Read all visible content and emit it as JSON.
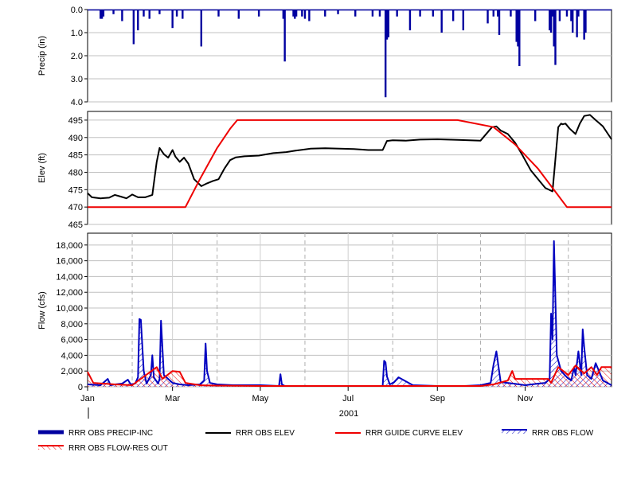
{
  "chart_data": [
    {
      "type": "bar",
      "panel": "precip",
      "ylabel": "Precip (in)",
      "ylim": [
        0,
        4
      ],
      "y_inverted": true,
      "yticks": [
        "0.0",
        "1.0",
        "2.0",
        "3.0",
        "4.0"
      ],
      "grid": true,
      "x_range": [
        "2001-01-01",
        "2001-12-31"
      ],
      "series": [
        {
          "name": "RRR OBS PRECIP-INC",
          "color": "#0000a0",
          "dates": [
            "2001-01-10",
            "2001-01-11",
            "2001-01-12",
            "2001-01-19",
            "2001-01-25",
            "2001-02-02",
            "2001-02-05",
            "2001-02-09",
            "2001-02-13",
            "2001-02-20",
            "2001-03-01",
            "2001-03-04",
            "2001-03-08",
            "2001-03-21",
            "2001-04-02",
            "2001-04-16",
            "2001-04-30",
            "2001-05-17",
            "2001-05-18",
            "2001-05-24",
            "2001-05-25",
            "2001-05-26",
            "2001-05-30",
            "2001-06-01",
            "2001-06-04",
            "2001-06-15",
            "2001-06-24",
            "2001-07-06",
            "2001-07-18",
            "2001-07-23",
            "2001-07-27",
            "2001-07-28",
            "2001-07-29",
            "2001-08-04",
            "2001-08-13",
            "2001-08-20",
            "2001-08-29",
            "2001-09-04",
            "2001-09-12",
            "2001-09-19",
            "2001-10-06",
            "2001-10-10",
            "2001-10-13",
            "2001-10-14",
            "2001-10-22",
            "2001-10-26",
            "2001-10-27",
            "2001-10-28",
            "2001-11-08",
            "2001-11-18",
            "2001-11-19",
            "2001-11-20",
            "2001-11-21",
            "2001-11-22",
            "2001-11-25",
            "2001-11-30",
            "2001-12-03",
            "2001-12-04",
            "2001-12-07",
            "2001-12-08",
            "2001-12-12",
            "2001-12-13"
          ],
          "values": [
            0.4,
            0.4,
            0.3,
            0.2,
            0.5,
            1.5,
            0.9,
            0.3,
            0.4,
            0.2,
            0.8,
            0.3,
            0.4,
            1.6,
            0.3,
            0.4,
            0.3,
            0.4,
            2.25,
            0.3,
            0.4,
            0.3,
            0.3,
            0.4,
            0.5,
            0.3,
            0.2,
            0.3,
            0.3,
            0.3,
            3.8,
            1.3,
            1.2,
            0.3,
            0.9,
            0.3,
            0.3,
            1.0,
            0.5,
            0.9,
            0.6,
            0.3,
            0.3,
            1.1,
            0.3,
            1.4,
            1.6,
            2.45,
            0.5,
            0.9,
            1.0,
            0.3,
            1.6,
            2.4,
            0.5,
            0.3,
            0.5,
            1.0,
            1.2,
            0.3,
            1.3,
            1.0
          ]
        }
      ]
    },
    {
      "type": "line",
      "panel": "elevation",
      "ylabel": "Elev (ft)",
      "ylim": [
        465,
        497.5
      ],
      "yticks": [
        "465",
        "470",
        "475",
        "480",
        "485",
        "490",
        "495"
      ],
      "grid": true,
      "x_range": [
        "2001-01-01",
        "2001-12-31"
      ],
      "series": [
        {
          "name": "RRR OBS ELEV",
          "color": "#000000",
          "dates": [
            "2001-01-01",
            "2001-01-04",
            "2001-01-10",
            "2001-01-16",
            "2001-01-20",
            "2001-01-24",
            "2001-01-28",
            "2001-02-01",
            "2001-02-05",
            "2001-02-10",
            "2001-02-15",
            "2001-02-18",
            "2001-02-20",
            "2001-02-23",
            "2001-02-26",
            "2001-03-01",
            "2001-03-03",
            "2001-03-06",
            "2001-03-09",
            "2001-03-12",
            "2001-03-16",
            "2001-03-21",
            "2001-03-25",
            "2001-03-29",
            "2001-04-02",
            "2001-04-06",
            "2001-04-10",
            "2001-04-14",
            "2001-04-20",
            "2001-04-30",
            "2001-05-10",
            "2001-05-19",
            "2001-05-25",
            "2001-06-05",
            "2001-06-15",
            "2001-06-25",
            "2001-07-05",
            "2001-07-15",
            "2001-07-25",
            "2001-07-28",
            "2001-08-01",
            "2001-08-10",
            "2001-08-20",
            "2001-09-01",
            "2001-09-15",
            "2001-10-01",
            "2001-10-09",
            "2001-10-12",
            "2001-10-15",
            "2001-10-20",
            "2001-10-25",
            "2001-10-30",
            "2001-11-05",
            "2001-11-10",
            "2001-11-15",
            "2001-11-20",
            "2001-11-24",
            "2001-11-26",
            "2001-11-27",
            "2001-11-29",
            "2001-12-02",
            "2001-12-06",
            "2001-12-09",
            "2001-12-12",
            "2001-12-16",
            "2001-12-20",
            "2001-12-25",
            "2001-12-31"
          ],
          "values": [
            474,
            472.8,
            472.5,
            472.7,
            473.5,
            473,
            472.5,
            473.6,
            472.8,
            472.8,
            473.5,
            483,
            487,
            485.2,
            484.2,
            486.4,
            484.5,
            483,
            484.2,
            482.5,
            478,
            476,
            476.8,
            477.5,
            478,
            481,
            483.5,
            484.3,
            484.6,
            484.8,
            485.5,
            485.8,
            486.2,
            486.8,
            486.9,
            486.8,
            486.7,
            486.4,
            486.4,
            489,
            489.2,
            489.1,
            489.4,
            489.5,
            489.3,
            489.1,
            493,
            493.2,
            492,
            491,
            488.5,
            485,
            480.5,
            478,
            475.5,
            474.5,
            493,
            494,
            493.8,
            494,
            492.5,
            491,
            494,
            496.2,
            496.5,
            495,
            493.2,
            489.5
          ]
        },
        {
          "name": "RRR GUIDE CURVE ELEV",
          "color": "#ee0000",
          "dates": [
            "2001-01-01",
            "2001-03-10",
            "2001-03-20",
            "2001-04-01",
            "2001-04-10",
            "2001-04-15",
            "2001-04-30",
            "2001-09-15",
            "2001-10-10",
            "2001-10-25",
            "2001-11-10",
            "2001-11-20",
            "2001-11-30",
            "2001-12-31"
          ],
          "values": [
            470,
            470,
            478,
            487,
            492.5,
            495,
            495,
            495,
            493,
            488,
            481,
            475.5,
            470,
            470
          ]
        }
      ]
    },
    {
      "type": "area",
      "panel": "flow",
      "ylabel": "Flow (cfs)",
      "ylim": [
        0,
        19500
      ],
      "yticks": [
        "0",
        "2,000",
        "4,000",
        "6,000",
        "8,000",
        "10,000",
        "12,000",
        "14,000",
        "16,000",
        "18,000"
      ],
      "grid": true,
      "x_range": [
        "2001-01-01",
        "2001-12-31"
      ],
      "xtick_labels": [
        "Jan",
        "Mar",
        "May",
        "Jul",
        "Sep",
        "Nov"
      ],
      "year_label": "2001",
      "series": [
        {
          "name": "RRR OBS FLOW",
          "color": "#0000c0",
          "dates": [
            "2001-01-01",
            "2001-01-10",
            "2001-01-15",
            "2001-01-17",
            "2001-01-20",
            "2001-01-25",
            "2001-01-29",
            "2001-01-31",
            "2001-02-03",
            "2001-02-05",
            "2001-02-06",
            "2001-02-07",
            "2001-02-09",
            "2001-02-11",
            "2001-02-14",
            "2001-02-15",
            "2001-02-16",
            "2001-02-19",
            "2001-02-20",
            "2001-02-21",
            "2001-02-23",
            "2001-03-01",
            "2001-03-06",
            "2001-03-12",
            "2001-03-20",
            "2001-03-23",
            "2001-03-24",
            "2001-03-25",
            "2001-03-27",
            "2001-04-01",
            "2001-04-12",
            "2001-05-01",
            "2001-05-14",
            "2001-05-15",
            "2001-05-16",
            "2001-05-18",
            "2001-06-01",
            "2001-06-20",
            "2001-07-10",
            "2001-07-25",
            "2001-07-26",
            "2001-07-27",
            "2001-07-28",
            "2001-07-30",
            "2001-08-02",
            "2001-08-05",
            "2001-08-15",
            "2001-09-01",
            "2001-09-20",
            "2001-10-01",
            "2001-10-08",
            "2001-10-10",
            "2001-10-12",
            "2001-10-15",
            "2001-10-24",
            "2001-10-28",
            "2001-11-01",
            "2001-11-10",
            "2001-11-15",
            "2001-11-18",
            "2001-11-19",
            "2001-11-20",
            "2001-11-21",
            "2001-11-23",
            "2001-11-26",
            "2001-11-30",
            "2001-12-03",
            "2001-12-05",
            "2001-12-06",
            "2001-12-08",
            "2001-12-10",
            "2001-12-11",
            "2001-12-12",
            "2001-12-14",
            "2001-12-17",
            "2001-12-20",
            "2001-12-25",
            "2001-12-31"
          ],
          "values": [
            300,
            200,
            1000,
            200,
            300,
            400,
            900,
            300,
            400,
            1200,
            8600,
            8500,
            2000,
            400,
            1500,
            4000,
            1200,
            400,
            1000,
            8400,
            1500,
            500,
            300,
            200,
            300,
            800,
            5500,
            2000,
            500,
            300,
            200,
            200,
            100,
            1600,
            300,
            100,
            100,
            100,
            100,
            100,
            3300,
            3100,
            1300,
            300,
            600,
            1200,
            200,
            100,
            100,
            200,
            500,
            2800,
            4500,
            600,
            400,
            300,
            200,
            400,
            500,
            1000,
            9300,
            6000,
            18500,
            4000,
            2000,
            1200,
            800,
            2500,
            1500,
            4500,
            1500,
            7300,
            5000,
            1500,
            1000,
            3000,
            800,
            200
          ]
        },
        {
          "name": "RRR OBS FLOW-RES OUT",
          "color": "#ee0000",
          "dates": [
            "2001-01-01",
            "2001-01-05",
            "2001-01-20",
            "2001-02-01",
            "2001-02-18",
            "2001-02-22",
            "2001-03-01",
            "2001-03-06",
            "2001-03-10",
            "2001-03-20",
            "2001-04-01",
            "2001-05-01",
            "2001-06-01",
            "2001-07-01",
            "2001-08-01",
            "2001-09-01",
            "2001-10-01",
            "2001-10-10",
            "2001-10-20",
            "2001-10-23",
            "2001-10-25",
            "2001-10-30",
            "2001-11-17",
            "2001-11-19",
            "2001-11-24",
            "2001-12-01",
            "2001-12-06",
            "2001-12-12",
            "2001-12-17",
            "2001-12-21",
            "2001-12-24",
            "2001-12-31"
          ],
          "values": [
            1900,
            500,
            300,
            200,
            2500,
            1000,
            2000,
            1900,
            500,
            200,
            150,
            100,
            100,
            100,
            100,
            100,
            100,
            300,
            800,
            2000,
            1000,
            1000,
            1000,
            500,
            2500,
            1500,
            2700,
            1700,
            2500,
            1500,
            2500,
            2500
          ]
        }
      ]
    }
  ],
  "legend": [
    {
      "label": "RRR OBS PRECIP-INC",
      "style": "thick-bar",
      "color": "#0000a0"
    },
    {
      "label": "RRR OBS ELEV",
      "style": "line",
      "color": "#000000"
    },
    {
      "label": "RRR GUIDE CURVE ELEV",
      "style": "line",
      "color": "#ee0000"
    },
    {
      "label": "RRR OBS FLOW",
      "style": "hatch",
      "color": "#0000c0"
    },
    {
      "label": "RRR OBS FLOW-RES OUT",
      "style": "hatch",
      "color": "#ee0000"
    }
  ]
}
